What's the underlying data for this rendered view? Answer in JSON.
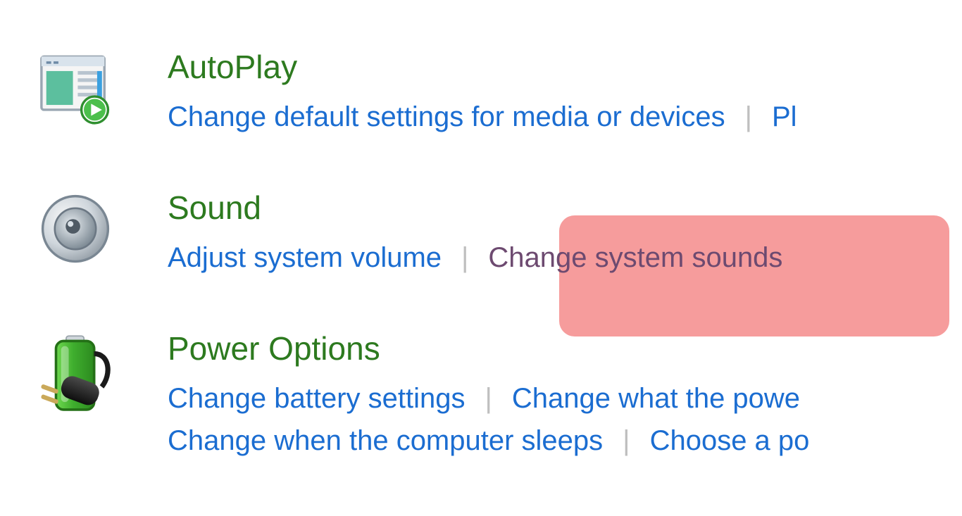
{
  "categories": {
    "autoplay": {
      "title": "AutoPlay",
      "links": {
        "change_defaults": "Change default settings for media or devices",
        "partial": "Pl"
      }
    },
    "sound": {
      "title": "Sound",
      "links": {
        "adjust_volume": "Adjust system volume",
        "change_sounds": "Change system sounds"
      }
    },
    "power": {
      "title": "Power Options",
      "links": {
        "change_battery": "Change battery settings",
        "change_what_power": "Change what the powe",
        "change_sleep": "Change when the computer sleeps",
        "choose_plan": "Choose a po"
      }
    }
  },
  "separator": "|"
}
